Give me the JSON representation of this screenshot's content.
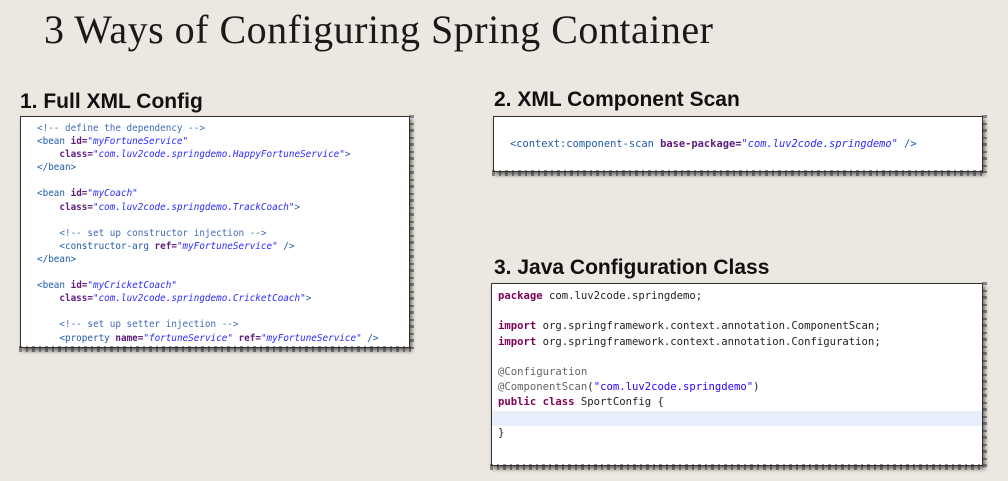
{
  "title": "3 Ways of Configuring Spring Container",
  "sections": [
    {
      "heading": "1. Full XML Config",
      "lines": [
        [
          {
            "c": "t-com",
            "t": "<!-- define the dependency -->"
          }
        ],
        [
          {
            "c": "t-tag",
            "t": "<bean "
          },
          {
            "c": "t-attr",
            "t": "id="
          },
          {
            "c": "t-str",
            "t": "\"myFortuneService\""
          }
        ],
        [
          {
            "c": "t-plain",
            "t": "    "
          },
          {
            "c": "t-attr",
            "t": "class="
          },
          {
            "c": "t-str",
            "t": "\"com.luv2code.springdemo.HappyFortuneService\""
          },
          {
            "c": "t-tag",
            "t": ">"
          }
        ],
        [
          {
            "c": "t-tag",
            "t": "</bean>"
          }
        ],
        [],
        [
          {
            "c": "t-tag",
            "t": "<bean "
          },
          {
            "c": "t-attr",
            "t": "id="
          },
          {
            "c": "t-str",
            "t": "\"myCoach\""
          }
        ],
        [
          {
            "c": "t-plain",
            "t": "    "
          },
          {
            "c": "t-attr",
            "t": "class="
          },
          {
            "c": "t-str",
            "t": "\"com.luv2code.springdemo.TrackCoach\""
          },
          {
            "c": "t-tag",
            "t": ">"
          }
        ],
        [],
        [
          {
            "c": "t-plain",
            "t": "    "
          },
          {
            "c": "t-com",
            "t": "<!-- set up constructor injection -->"
          }
        ],
        [
          {
            "c": "t-plain",
            "t": "    "
          },
          {
            "c": "t-tag",
            "t": "<constructor-arg "
          },
          {
            "c": "t-attr",
            "t": "ref="
          },
          {
            "c": "t-str",
            "t": "\"myFortuneService\""
          },
          {
            "c": "t-tag",
            "t": " />"
          }
        ],
        [
          {
            "c": "t-tag",
            "t": "</bean>"
          }
        ],
        [],
        [
          {
            "c": "t-tag",
            "t": "<bean "
          },
          {
            "c": "t-attr",
            "t": "id="
          },
          {
            "c": "t-str",
            "t": "\"myCricketCoach\""
          }
        ],
        [
          {
            "c": "t-plain",
            "t": "    "
          },
          {
            "c": "t-attr",
            "t": "class="
          },
          {
            "c": "t-str",
            "t": "\"com.luv2code.springdemo.CricketCoach\""
          },
          {
            "c": "t-tag",
            "t": ">"
          }
        ],
        [],
        [
          {
            "c": "t-plain",
            "t": "    "
          },
          {
            "c": "t-com",
            "t": "<!-- set up setter injection -->"
          }
        ],
        [
          {
            "c": "t-plain",
            "t": "    "
          },
          {
            "c": "t-tag",
            "t": "<property "
          },
          {
            "c": "t-attr",
            "t": "name="
          },
          {
            "c": "t-str",
            "t": "\"fortuneService\""
          },
          {
            "c": "t-attr",
            "t": " ref="
          },
          {
            "c": "t-str",
            "t": "\"myFortuneService\""
          },
          {
            "c": "t-tag",
            "t": " />"
          }
        ]
      ]
    },
    {
      "heading": "2. XML Component Scan",
      "lines": [
        [
          {
            "c": "t-tag",
            "t": "<context:component-scan "
          },
          {
            "c": "t-attr",
            "t": "base-package="
          },
          {
            "c": "t-str",
            "t": "\"com.luv2code.springdemo\""
          },
          {
            "c": "t-tag",
            "t": " />"
          }
        ]
      ]
    },
    {
      "heading": "3. Java Configuration Class",
      "lines": [
        [
          {
            "c": "t-kw",
            "t": "package"
          },
          {
            "c": "t-plain",
            "t": " com.luv2code.springdemo;"
          }
        ],
        [],
        [
          {
            "c": "t-kw",
            "t": "import"
          },
          {
            "c": "t-plain",
            "t": " org.springframework.context.annotation.ComponentScan;"
          }
        ],
        [
          {
            "c": "t-kw",
            "t": "import"
          },
          {
            "c": "t-plain",
            "t": " org.springframework.context.annotation.Configuration;"
          }
        ],
        [],
        [
          {
            "c": "t-ann",
            "t": "@Configuration"
          }
        ],
        [
          {
            "c": "t-ann",
            "t": "@ComponentScan"
          },
          {
            "c": "t-plain",
            "t": "("
          },
          {
            "c": "t-jstr",
            "t": "\"com.luv2code.springdemo\""
          },
          {
            "c": "t-plain",
            "t": ")"
          }
        ],
        [
          {
            "c": "t-kw",
            "t": "public class"
          },
          {
            "c": "t-plain",
            "t": " SportConfig {"
          }
        ],
        [],
        [
          {
            "c": "t-plain",
            "t": "}"
          }
        ]
      ],
      "highlight_line": 8
    }
  ]
}
